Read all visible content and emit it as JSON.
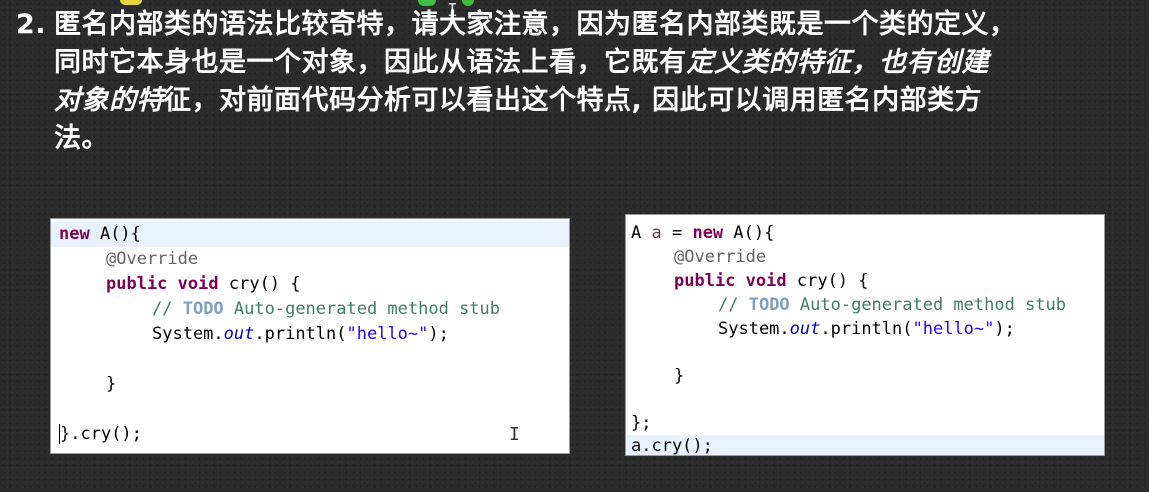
{
  "slide": {
    "number": "2.",
    "line1": "匿名内部类的语法比较奇特，请大家注意，因为匿名内部类既是一个类的定义，",
    "line2_plain": "同时它本身也是一个对象，因此从语法上看，它既有",
    "line2_italic": "定义类的特征，也有创建",
    "line3_italic": "对象的特",
    "line3_plain": "征，对前面代码分析可以看出这个特点, 因此可以调用匿名内部类方",
    "line4": "法。"
  },
  "left_code": {
    "l1_new": "new",
    "l1_rest": " A(){",
    "l2_annotation": "@Override",
    "l3_public": "public",
    "l3_void": "void",
    "l3_rest": " cry() {",
    "l4_comment_prefix": "// ",
    "l4_todo": "TODO",
    "l4_comment_rest": " Auto-generated method stub",
    "l5_system": "System.",
    "l5_out": "out",
    "l5_println": ".println(",
    "l5_string": "\"hello~\"",
    "l5_end": ");",
    "l7_brace": "}",
    "l9_brace": "}",
    "l9_rest": ".cry();"
  },
  "right_code": {
    "l1_type": "A ",
    "l1_var": "a",
    "l1_eq": " = ",
    "l1_new": "new",
    "l1_rest": " A(){",
    "l2_annotation": "@Override",
    "l3_public": "public",
    "l3_void": "void",
    "l3_rest": " cry() {",
    "l4_comment_prefix": "// ",
    "l4_todo": "TODO",
    "l4_comment_rest": " Auto-generated method stub",
    "l5_system": "System.",
    "l5_out": "out",
    "l5_println": ".println(",
    "l5_string": "\"hello~\"",
    "l5_end": ");",
    "l7_brace": "}",
    "l9_close": "};",
    "l10_call": "a.cry();"
  },
  "icons": {
    "text_cursor": "I"
  },
  "colors": {
    "keyword": "#7f0055",
    "string": "#2a00ff",
    "comment": "#3f7f5f",
    "field": "#0000c0",
    "todo": "#7f9fbf",
    "highlight_line": "#e8f2fe"
  }
}
